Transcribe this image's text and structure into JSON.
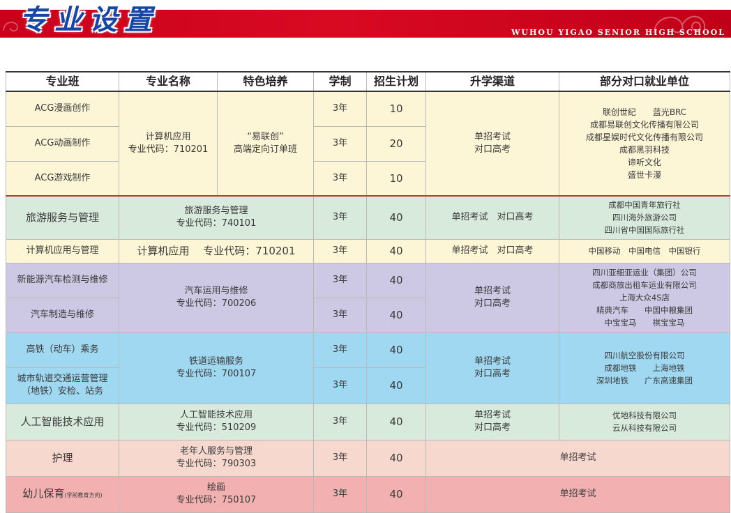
{
  "banner": {
    "title": "专业设置",
    "school": "WUHOU YIGAO SENIOR HIGH SCHOOL",
    "color": "#c8001a"
  },
  "headers": [
    "专业班",
    "专业名称",
    "特色培养",
    "学制",
    "招生计划",
    "升学渠道",
    "部分对口就业单位"
  ],
  "acg": {
    "majors": [
      "ACG漫画创作",
      "ACG动画制作",
      "ACG游戏制作"
    ],
    "name": "计算机应用",
    "code": "专业代码：710201",
    "feature_1": "“易联创”",
    "feature_2": "高端定向订单班",
    "years": [
      "3年",
      "3年",
      "3年"
    ],
    "plans": [
      "10",
      "20",
      "10"
    ],
    "channel_1": "单招考试",
    "channel_2": "对口高考",
    "employers": [
      "联创世纪　　蓝光BRC",
      "成都易联创文化传播有限公司",
      "成都星娱时代文化传播有限公司",
      "成都黑羽科技",
      "谛听文化",
      "盛世卡漫"
    ]
  },
  "tourism": {
    "major": "旅游服务与管理",
    "name": "旅游服务与管理",
    "code": "专业代码：740101",
    "years": "3年",
    "plan": "40",
    "channel": "单招考试　对口高考",
    "employers": [
      "成都中国青年旅行社",
      "四川海外旅游公司",
      "四川省中国国际旅行社"
    ]
  },
  "computer": {
    "major": "计算机应用与管理",
    "name": "计算机应用　 专业代码：710201",
    "years": "3年",
    "plan": "40",
    "channel": "单招考试　对口高考",
    "employers": "中国移动　中国电信　中国银行"
  },
  "auto": {
    "majors": [
      "新能源汽车检测与维修",
      "汽车制造与维修"
    ],
    "name": "汽车运用与维修",
    "code": "专业代码：700206",
    "years": [
      "3年",
      "3年"
    ],
    "plans": [
      "40",
      "40"
    ],
    "channel_1": "单招考试",
    "channel_2": "对口高考",
    "employers": [
      "四川亚细亚运业（集团）公司",
      "成都商旅出租车运业有限公司",
      "上海大众4S店",
      "精典汽车　　中国中粮集团",
      "中宝宝马　　祺宝宝马"
    ]
  },
  "rail": {
    "majors": [
      "高铁（动车）乘务",
      "城市轨道交通运营管理",
      "（地铁）安检、站务"
    ],
    "name": "铁道运输服务",
    "code": "专业代码：700107",
    "years": [
      "3年",
      "3年"
    ],
    "plans": [
      "40",
      "40"
    ],
    "channel_1": "单招考试",
    "channel_2": "对口高考",
    "employers": [
      "四川航空股份有限公司",
      "成都地铁　　上海地铁",
      "深圳地铁　　广东高速集团"
    ]
  },
  "ai": {
    "major": "人工智能技术应用",
    "name": "人工智能技术应用",
    "code": "专业代码：510209",
    "years": "3年",
    "plan": "40",
    "channel_1": "单招考试",
    "channel_2": "对口高考",
    "employers": [
      "优地科技有限公司",
      "云从科技有限公司"
    ]
  },
  "nursing": {
    "major": "护理",
    "name": "老年人服务与管理",
    "code": "专业代码：790303",
    "years": "3年",
    "plan": "40",
    "channel": "单招考试"
  },
  "childcare": {
    "major": "幼儿保育",
    "major_note": "(学前教育方向)",
    "name": "绘画",
    "code": "专业代码：750107",
    "years": "3年",
    "plan": "40",
    "channel": "单招考试"
  }
}
